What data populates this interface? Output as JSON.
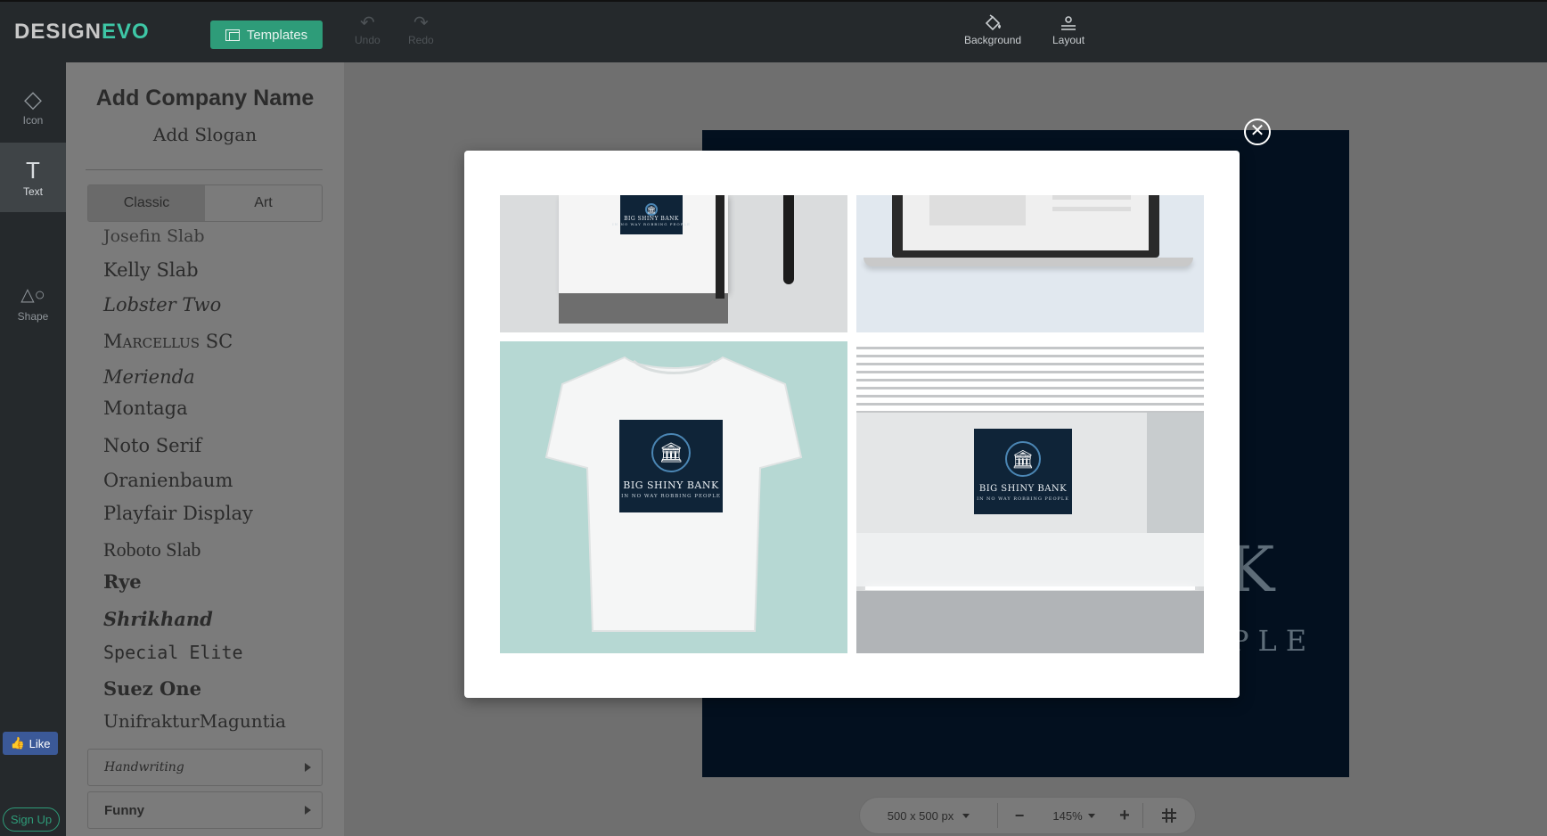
{
  "app": {
    "logo_main": "DESIGN",
    "logo_accent": "EVO",
    "templates_label": "Templates",
    "undo_label": "Undo",
    "redo_label": "Redo",
    "background_label": "Background",
    "layout_label": "Layout",
    "brand_color": "#3ec7a6",
    "button_color": "#2e9c79"
  },
  "rail": {
    "items": [
      {
        "label": "Icon",
        "icon": "diamond-icon"
      },
      {
        "label": "Text",
        "icon": "text-t-icon"
      },
      {
        "label": "Shape",
        "icon": "shapes-icon"
      }
    ],
    "like_label": "Like",
    "signup_label": "Sign Up"
  },
  "text_panel": {
    "company_placeholder": "Add Company Name",
    "slogan_placeholder": "Add Slogan",
    "tabs": [
      "Classic",
      "Art"
    ],
    "active_tab": "Classic",
    "fonts": [
      "Josefin Slab",
      "Kelly Slab",
      "Lobster Two",
      "Marcellus SC",
      "Merienda",
      "Montaga",
      "Noto Serif",
      "Oranienbaum",
      "Playfair Display",
      "Roboto Slab",
      "Rye",
      "Shrikhand",
      "Special Elite",
      "Suez One",
      "UnifrakturMaguntia"
    ],
    "categories": [
      "Handwriting",
      "Funny"
    ]
  },
  "canvas": {
    "title_fragment": "K",
    "slogan_fragment": "PLE",
    "background_color": "#03101f"
  },
  "zoom_bar": {
    "size": "500 x 500 px",
    "zoom": "145%",
    "minus": "−",
    "plus": "+"
  },
  "preview_modal": {
    "logo_name": "BIG SHINY BANK",
    "logo_slogan": "IN NO WAY ROBBING PEOPLE",
    "mockups": [
      "notebook-mockup",
      "laptop-mockup",
      "tshirt-mockup",
      "office-wall-mockup"
    ]
  }
}
